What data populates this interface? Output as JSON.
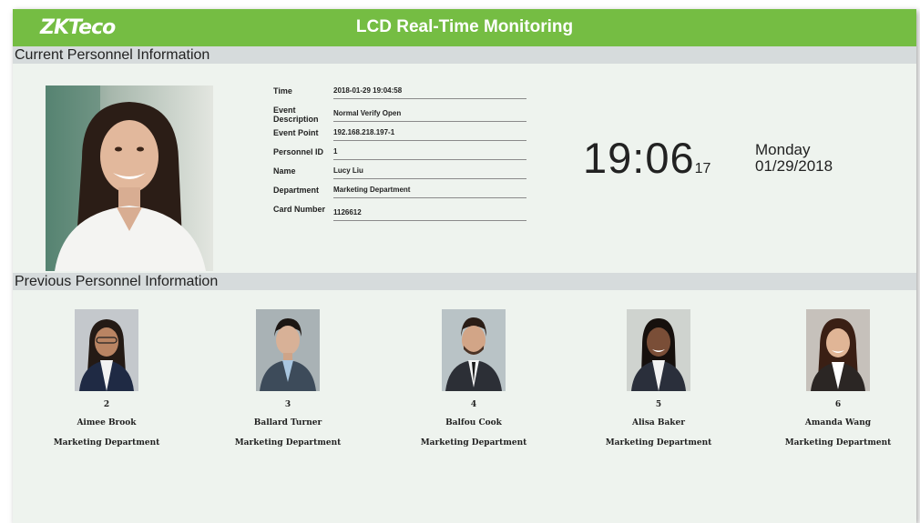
{
  "header": {
    "logo_text": "ZKTeco",
    "title": "LCD Real-Time Monitoring",
    "color": "#75bd43"
  },
  "current": {
    "section_title": "Current Personnel Information",
    "fields": [
      {
        "label": "Time",
        "value": "2018-01-29 19:04:58"
      },
      {
        "label": "Event Description",
        "value": "Normal Verify Open"
      },
      {
        "label": "Event Point",
        "value": "192.168.218.197-1"
      },
      {
        "label": "Personnel ID",
        "value": "1"
      },
      {
        "label": "Name",
        "value": "Lucy Liu"
      },
      {
        "label": "Department",
        "value": "Marketing Department"
      },
      {
        "label": "Card Number",
        "value": "1126612"
      }
    ]
  },
  "clock": {
    "hm": "19:06",
    "sec": "17",
    "weekday": "Monday",
    "date": "01/29/2018"
  },
  "previous": {
    "section_title": "Previous Personnel Information",
    "people": [
      {
        "id": "2",
        "name": "Aimee Brook",
        "department": "Marketing Department"
      },
      {
        "id": "3",
        "name": "Ballard Turner",
        "department": "Marketing Department"
      },
      {
        "id": "4",
        "name": "Balfou Cook",
        "department": "Marketing Department"
      },
      {
        "id": "5",
        "name": "Alisa Baker",
        "department": "Marketing Department"
      },
      {
        "id": "6",
        "name": "Amanda Wang",
        "department": "Marketing Department"
      }
    ]
  }
}
